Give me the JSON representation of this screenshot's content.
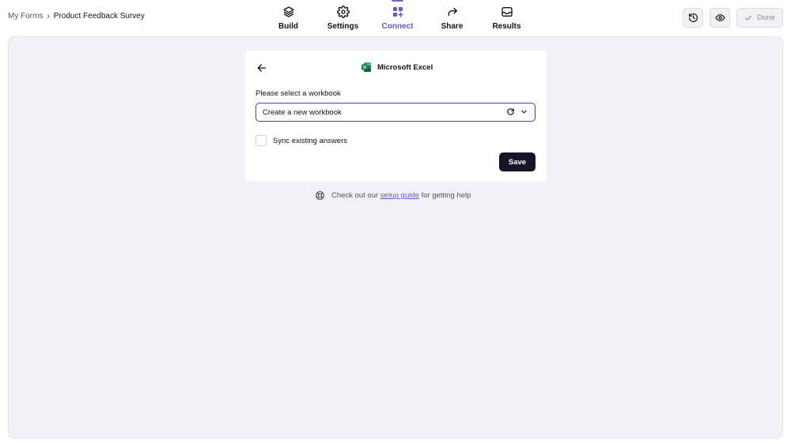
{
  "breadcrumb": {
    "parent": "My Forms",
    "current": "Product Feedback Survey"
  },
  "tabs": [
    {
      "label": "Build",
      "icon": "layers-icon"
    },
    {
      "label": "Settings",
      "icon": "gear-icon"
    },
    {
      "label": "Connect",
      "icon": "grid-plus-icon",
      "active": true
    },
    {
      "label": "Share",
      "icon": "share-arrow-icon"
    },
    {
      "label": "Results",
      "icon": "inbox-icon"
    }
  ],
  "actions": {
    "history_icon": "history-icon",
    "preview_icon": "eye-icon",
    "done_label": "Done"
  },
  "card": {
    "title": "Microsoft Excel",
    "workbook_label": "Please select a workbook",
    "workbook_value": "Create a new workbook",
    "sync_label": "Sync existing answers",
    "save_label": "Save"
  },
  "help": {
    "prefix": "Check out our",
    "link": "setup guide",
    "suffix": "for getting help"
  },
  "colors": {
    "accent": "#6f56c4",
    "save_button": "#141628",
    "canvas": "#f1f2f7",
    "excel_green": "#1f7a44"
  }
}
